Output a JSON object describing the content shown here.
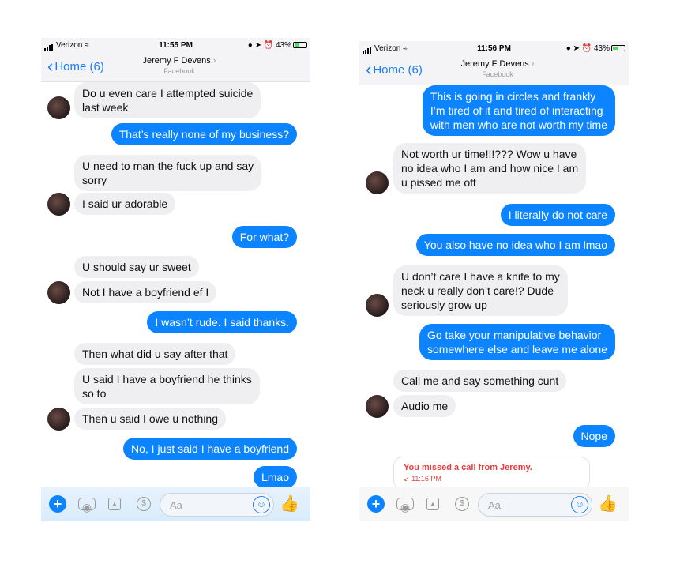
{
  "left": {
    "status": {
      "carrier": "Verizon",
      "time": "11:55 PM",
      "battery": "43%"
    },
    "nav": {
      "back": "Home (6)",
      "title": "Jeremy F Devens",
      "subtitle": "Facebook"
    },
    "messages": [
      {
        "dir": "in",
        "text": "Do u even care I attempted suicide\nlast week"
      },
      {
        "dir": "out",
        "text": "That’s really none of my business?"
      },
      {
        "dir": "in",
        "text": "U need to man the fuck up and say\nsorry"
      },
      {
        "dir": "in",
        "text": "I said ur adorable"
      },
      {
        "dir": "out",
        "text": "For what?"
      },
      {
        "dir": "in",
        "text": "U should say ur sweet"
      },
      {
        "dir": "in",
        "text": "Not I have a boyfriend ef I"
      },
      {
        "dir": "out",
        "text": "I wasn’t rude. I said thanks."
      },
      {
        "dir": "in",
        "text": "Then what did u say after that"
      },
      {
        "dir": "in",
        "text": "U said I have a boyfriend he thinks\nso to"
      },
      {
        "dir": "in",
        "text": "Then u said I owe u nothing"
      },
      {
        "dir": "out",
        "text": "No, I just said I have a boyfriend"
      },
      {
        "dir": "out",
        "text": "Lmao"
      }
    ],
    "composer": {
      "placeholder": "Aa"
    }
  },
  "right": {
    "status": {
      "carrier": "Verizon",
      "time": "11:56 PM",
      "battery": "43%"
    },
    "nav": {
      "back": "Home (6)",
      "title": "Jeremy F Devens",
      "subtitle": "Facebook"
    },
    "messages": [
      {
        "dir": "out",
        "text": "This is going in circles and frankly\nI’m tired of it and tired of interacting\nwith men who are not worth my time"
      },
      {
        "dir": "in",
        "text": "Not worth ur time!!!??? Wow u have\nno idea who I am and how nice I am\nu pissed me off"
      },
      {
        "dir": "out",
        "text": "I literally do not care"
      },
      {
        "dir": "out",
        "text": "You also have no idea who I am lmao"
      },
      {
        "dir": "in",
        "text": "U don’t care I have a knife to my\nneck u really don’t care!? Dude\nseriously grow up"
      },
      {
        "dir": "out",
        "text": "Go take your manipulative behavior\nsomewhere else and leave me alone"
      },
      {
        "dir": "in",
        "text": "Call me and say something cunt"
      },
      {
        "dir": "in",
        "text": "Audio me"
      },
      {
        "dir": "out",
        "text": "Nope"
      }
    ],
    "missed_call": {
      "text": "You missed a call from Jeremy.",
      "time": "11:16 PM"
    },
    "composer": {
      "placeholder": "Aa"
    }
  },
  "colors": {
    "outgoing": "#0d84ff",
    "incoming": "#efeff1",
    "accent": "#1a7cf5",
    "missed": "#e53e3e"
  },
  "icons": [
    "add-icon",
    "camera-icon",
    "image-icon",
    "payment-icon",
    "emoji-icon",
    "thumbs-up-icon"
  ]
}
